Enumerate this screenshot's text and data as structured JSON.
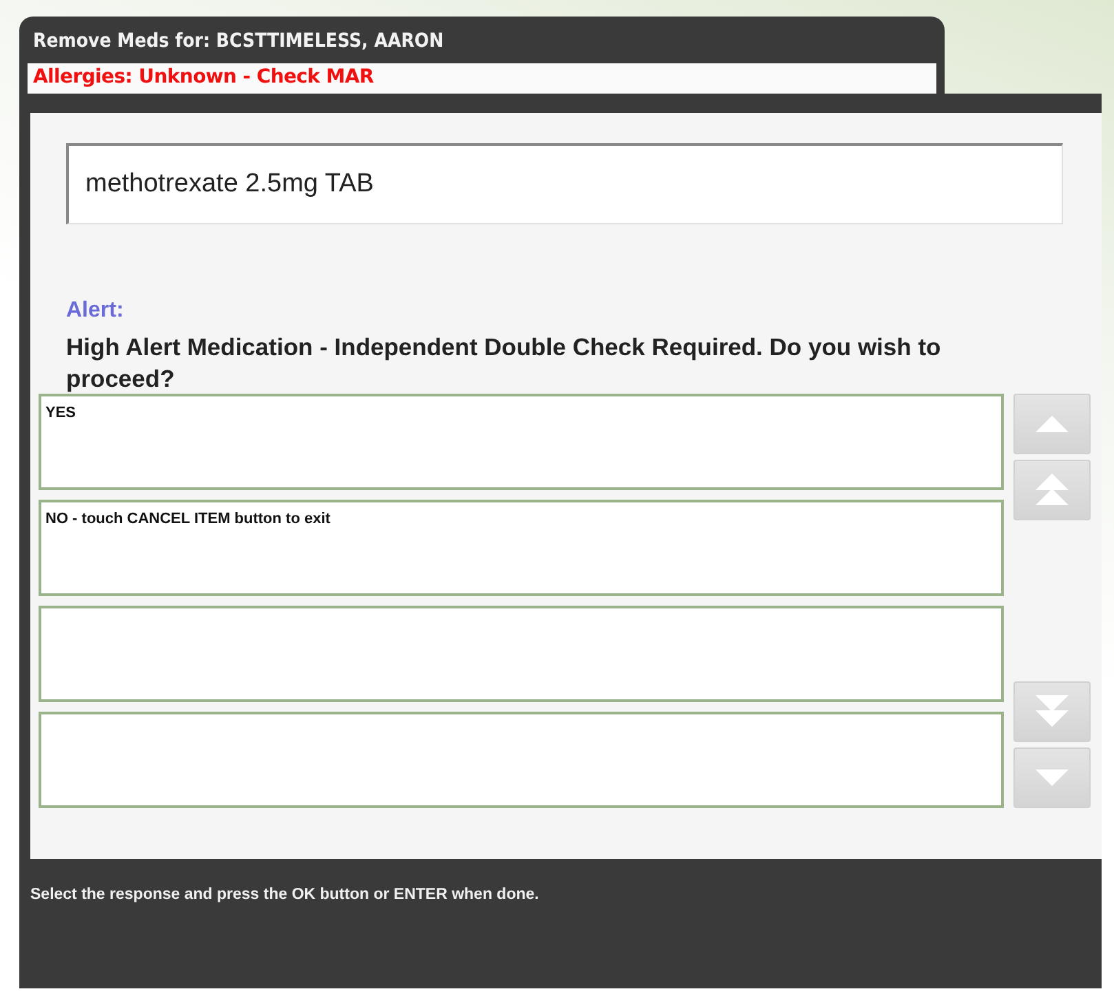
{
  "header": {
    "title": "Remove Meds for: BCSTTIMELESS, AARON",
    "allergies": "Allergies: Unknown - Check MAR"
  },
  "medication_field": {
    "value": "methotrexate 2.5mg TAB"
  },
  "alert": {
    "label": "Alert:",
    "message": "High Alert Medication - Independent Double Check Required. Do you wish to proceed?"
  },
  "responses": [
    {
      "kind": "answer",
      "text": "YES"
    },
    {
      "kind": "answer",
      "text": "NO - touch CANCEL ITEM button to exit"
    },
    {
      "kind": "blank"
    },
    {
      "kind": "blank"
    }
  ],
  "scroll_buttons": [
    {
      "kind": "up"
    },
    {
      "kind": "top"
    },
    {
      "kind": "bottom"
    },
    {
      "kind": "down"
    }
  ],
  "status_bar": {
    "text": "Select the response and press the OK button or ENTER when done."
  }
}
